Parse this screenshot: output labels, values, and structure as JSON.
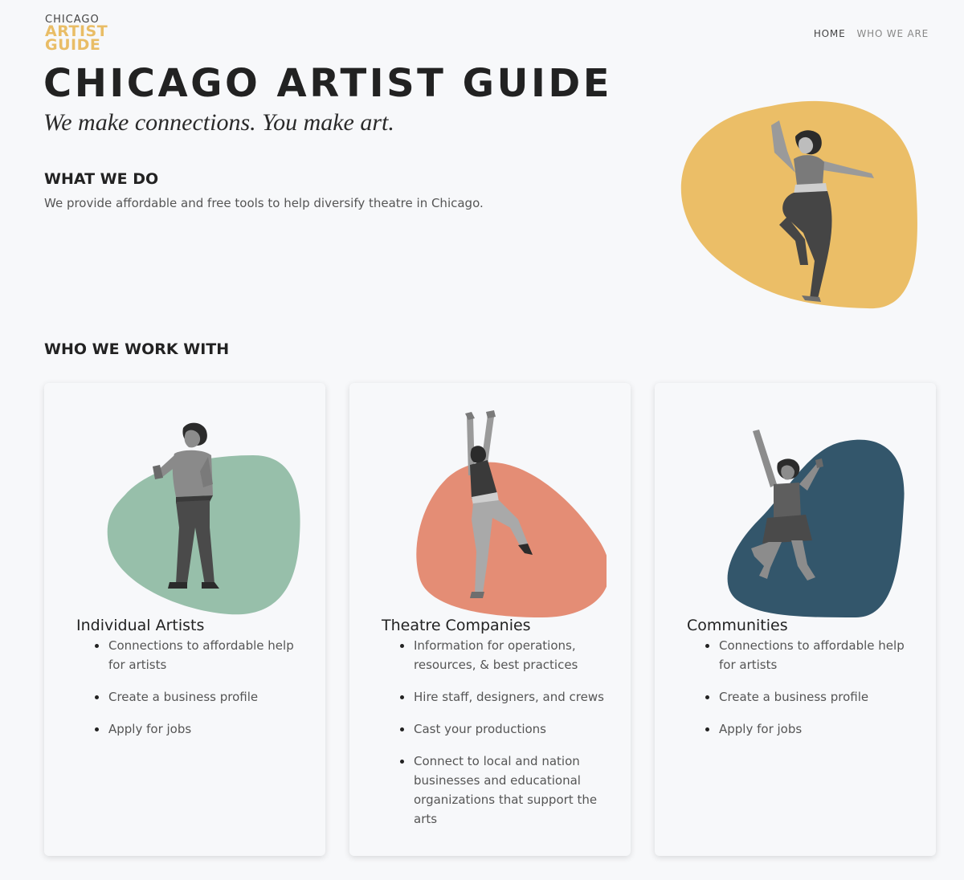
{
  "brand": {
    "logo_line1": "CHICAGO",
    "logo_line2": "ARTIST",
    "logo_line3": "GUIDE"
  },
  "nav": {
    "home": "HOME",
    "who_we_are": "WHO WE ARE"
  },
  "hero": {
    "title": "CHICAGO ARTIST GUIDE",
    "tagline": "We make connections. You make art."
  },
  "what_we_do": {
    "heading": "WHAT WE DO",
    "text": "We provide affordable and free tools to help diversify theatre in Chicago."
  },
  "who_we_work_with": {
    "heading": "WHO WE WORK WITH",
    "cards": [
      {
        "title": "Individual Artists",
        "items": [
          "Connections to affordable help for artists",
          "Create a business profile",
          "Apply for jobs"
        ]
      },
      {
        "title": "Theatre Companies",
        "items": [
          "Information for operations, resources, & best practices",
          "Hire staff, designers, and crews",
          "Cast your productions",
          "Connect to local and nation businesses and educational organizations that support the arts"
        ]
      },
      {
        "title": "Communities",
        "items": [
          "Connections to affordable help for artists",
          "Create a business profile",
          "Apply for jobs"
        ]
      }
    ]
  },
  "colors": {
    "background": "#f7f8fa",
    "brand_yellow": "#e9bd66",
    "blob_yellow": "#ebbe67",
    "blob_green": "#97bfaa",
    "blob_coral": "#e48d75",
    "blob_navy": "#33566b"
  }
}
